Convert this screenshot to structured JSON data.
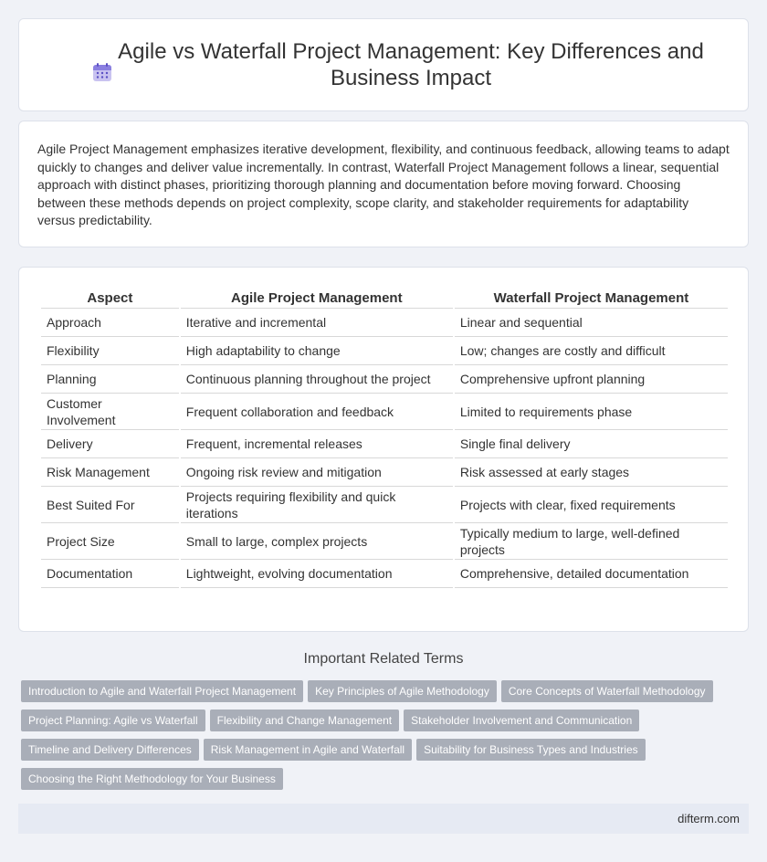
{
  "header": {
    "title": "Agile vs Waterfall Project Management: Key Differences and Business Impact",
    "icon": "calendar-icon"
  },
  "intro": {
    "text": "Agile Project Management emphasizes iterative development, flexibility, and continuous feedback, allowing teams to adapt quickly to changes and deliver value incrementally. In contrast, Waterfall Project Management follows a linear, sequential approach with distinct phases, prioritizing thorough planning and documentation before moving forward. Choosing between these methods depends on project complexity, scope clarity, and stakeholder requirements for adaptability versus predictability."
  },
  "table": {
    "headers": [
      "Aspect",
      "Agile Project Management",
      "Waterfall Project Management"
    ],
    "rows": [
      [
        "Approach",
        "Iterative and incremental",
        "Linear and sequential"
      ],
      [
        "Flexibility",
        "High adaptability to change",
        "Low; changes are costly and difficult"
      ],
      [
        "Planning",
        "Continuous planning throughout the project",
        "Comprehensive upfront planning"
      ],
      [
        "Customer Involvement",
        "Frequent collaboration and feedback",
        "Limited to requirements phase"
      ],
      [
        "Delivery",
        "Frequent, incremental releases",
        "Single final delivery"
      ],
      [
        "Risk Management",
        "Ongoing risk review and mitigation",
        "Risk assessed at early stages"
      ],
      [
        "Best Suited For",
        "Projects requiring flexibility and quick iterations",
        "Projects with clear, fixed requirements"
      ],
      [
        "Project Size",
        "Small to large, complex projects",
        "Typically medium to large, well-defined projects"
      ],
      [
        "Documentation",
        "Lightweight, evolving documentation",
        "Comprehensive, detailed documentation"
      ]
    ]
  },
  "related": {
    "title": "Important Related Terms",
    "tags": [
      "Introduction to Agile and Waterfall Project Management",
      "Key Principles of Agile Methodology",
      "Core Concepts of Waterfall Methodology",
      "Project Planning: Agile vs Waterfall",
      "Flexibility and Change Management",
      "Stakeholder Involvement and Communication",
      "Timeline and Delivery Differences",
      "Risk Management in Agile and Waterfall",
      "Suitability for Business Types and Industries",
      "Choosing the Right Methodology for Your Business"
    ]
  },
  "footer": {
    "site": "difterm.com"
  },
  "colors": {
    "background": "#f0f2f7",
    "tag": "#a9aeb8",
    "footer": "#e6eaf3"
  }
}
